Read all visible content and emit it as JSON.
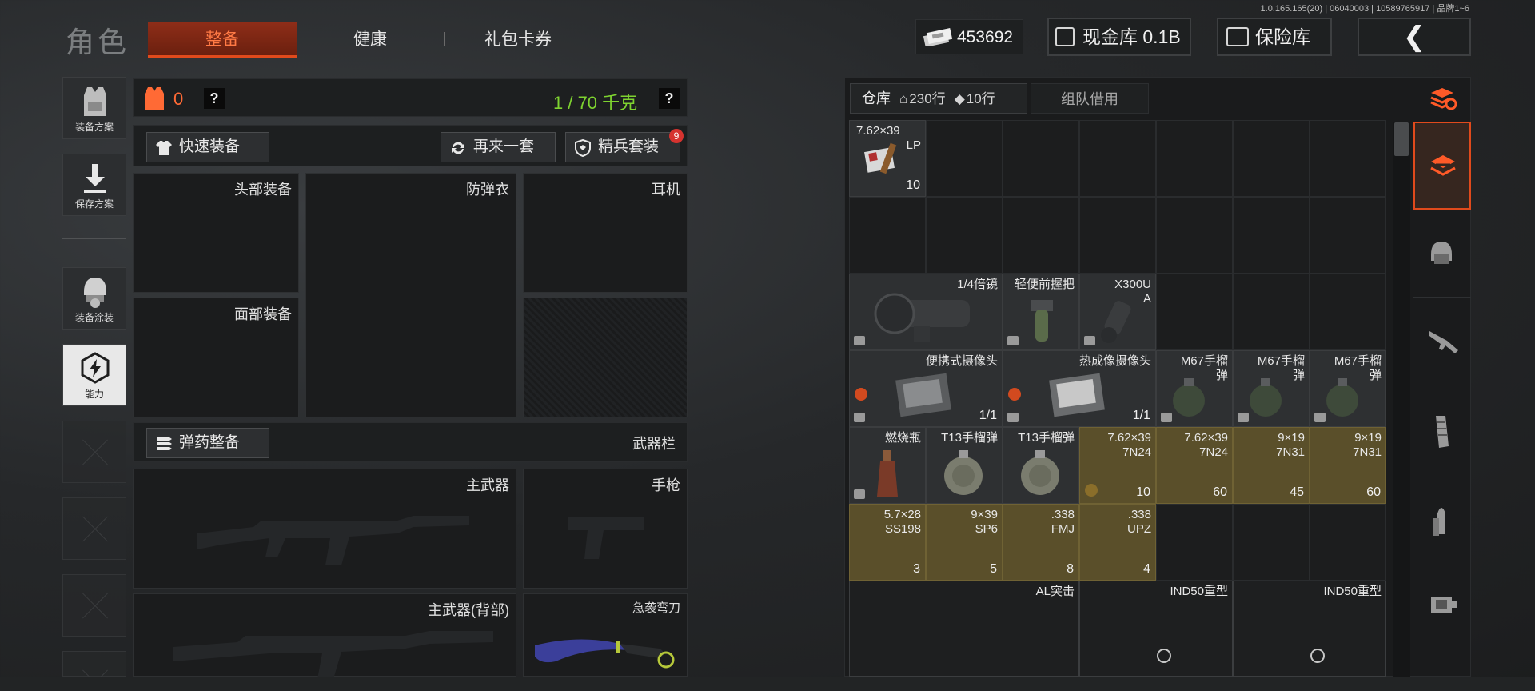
{
  "version": "1.0.165.165(20) | 06040003 | 10589765917 | 品牌1~6",
  "header": {
    "title": "角色",
    "tabs": [
      {
        "label": "整备",
        "active": true
      },
      {
        "label": "健康",
        "active": false
      },
      {
        "label": "礼包卡券",
        "active": false
      }
    ],
    "money": "453692",
    "cash_vault_label": "现金库 0.1B",
    "safe_label": "保险库",
    "back_icon": "chevron-left-icon"
  },
  "sidebar": {
    "items": [
      {
        "label": "装备方案",
        "icon": "vest-icon"
      },
      {
        "label": "保存方案",
        "icon": "download-icon"
      },
      {
        "label": "装备涂装",
        "icon": "helmet-paint-icon"
      },
      {
        "label": "能力",
        "icon": "ability-hex-icon",
        "active": true
      }
    ]
  },
  "loadout": {
    "vest_count": "0",
    "weight": "1 / 70 千克",
    "help": "?",
    "quick_equip": "快速装备",
    "again_set": "再来一套",
    "elite_set": "精兵套装",
    "elite_badge": "9",
    "slots": {
      "head": "头部装备",
      "armor": "防弹衣",
      "headset": "耳机",
      "face": "面部装备"
    },
    "ammo_equip": "弹药整备",
    "weapon_bar": "武器栏",
    "weapons": {
      "primary": "主武器",
      "pistol": "手枪",
      "primary_back": "主武器(背部)",
      "melee": "急袭弯刀"
    }
  },
  "warehouse": {
    "tab_label": "仓库",
    "rows_home": "230行",
    "rows_ticket": "10行",
    "team_borrow": "组队借用",
    "items": [
      {
        "name": "7.62×39",
        "suffix": "LP",
        "count": "10"
      },
      {
        "name": "1/4倍镜"
      },
      {
        "name": "轻便前握把"
      },
      {
        "name": "X300U",
        "suffix": "A"
      },
      {
        "name": "便携式摄像头",
        "count": "1/1"
      },
      {
        "name": "热成像摄像头",
        "count": "1/1"
      },
      {
        "name": "M67手榴",
        "suffix": "弹"
      },
      {
        "name": "M67手榴",
        "suffix": "弹"
      },
      {
        "name": "M67手榴",
        "suffix": "弹"
      },
      {
        "name": "燃烧瓶"
      },
      {
        "name": "T13手榴弹"
      },
      {
        "name": "T13手榴弹"
      },
      {
        "name": "7.62×39",
        "suffix": "7N24",
        "count": "10"
      },
      {
        "name": "7.62×39",
        "suffix": "7N24",
        "count": "60"
      },
      {
        "name": "9×19",
        "suffix": "7N31",
        "count": "45"
      },
      {
        "name": "9×19",
        "suffix": "7N31",
        "count": "60"
      },
      {
        "name": "5.7×28",
        "suffix": "SS198",
        "count": "3"
      },
      {
        "name": "9×39",
        "suffix": "SP6",
        "count": "5"
      },
      {
        "name": ".338",
        "suffix": "FMJ",
        "count": "8"
      },
      {
        "name": ".338",
        "suffix": "UPZ",
        "count": "4"
      },
      {
        "name": "AL突击"
      },
      {
        "name": "IND50重型"
      },
      {
        "name": "IND50重型"
      }
    ]
  },
  "rail": [
    "stack-refresh-icon",
    "all-items-icon",
    "helmet-icon",
    "rifle-icon",
    "magazine-icon",
    "bullet-icon",
    "sight-icon"
  ]
}
